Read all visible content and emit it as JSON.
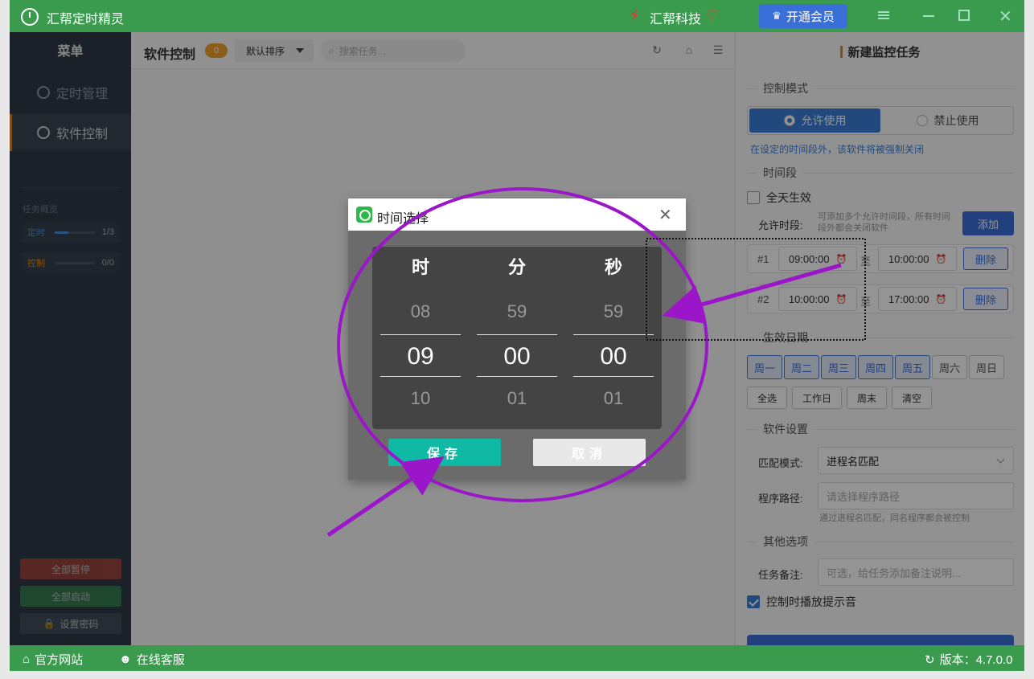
{
  "app": {
    "title": "汇帮定时精灵",
    "brand": "汇帮科技",
    "vip_label": "开通会员"
  },
  "sidebar": {
    "menu_title": "菜单",
    "items": [
      {
        "label": "定时管理",
        "icon": "alarm-clock-icon"
      },
      {
        "label": "软件控制",
        "icon": "gear-icon"
      }
    ],
    "overview_title": "任务概览",
    "overview": [
      {
        "label": "定时",
        "count": "1/3",
        "progress": 0.33
      },
      {
        "label": "控制",
        "count": "0/0",
        "progress": 0
      }
    ],
    "pause_all": "全部暂停",
    "start_all": "全部启动",
    "set_password": "设置密码"
  },
  "main": {
    "title": "软件控制",
    "count": "0",
    "sort": "默认排序",
    "search_placeholder": "搜索任务..."
  },
  "right": {
    "title": "新建监控任务",
    "mode_section": "控制模式",
    "mode_allow": "允许使用",
    "mode_deny": "禁止使用",
    "mode_hint": "在设定的时间段外，该软件将被强制关闭",
    "period_section": "时间段",
    "allday": "全天生效",
    "allow_label": "允许时段:",
    "allow_hint": "可添加多个允许时间段，所有时间段外都会关闭软件",
    "add": "添加",
    "periods": [
      {
        "index": "#1",
        "start": "09:00:00",
        "to": "至",
        "end": "10:00:00",
        "delete": "删除"
      },
      {
        "index": "#2",
        "start": "10:00:00",
        "to": "至",
        "end": "17:00:00",
        "delete": "删除"
      }
    ],
    "date_section": "生效日期",
    "days": [
      "周一",
      "周二",
      "周三",
      "周四",
      "周五",
      "周六",
      "周日"
    ],
    "days_selected": [
      true,
      true,
      true,
      true,
      true,
      false,
      false
    ],
    "quick": [
      "全选",
      "工作日",
      "周末",
      "清空"
    ],
    "software_section": "软件设置",
    "match_label": "匹配模式:",
    "match_value": "进程名匹配",
    "path_label": "程序路径:",
    "path_placeholder": "请选择程序路径",
    "path_hint": "通过进程名匹配，同名程序都会被控制",
    "other_section": "其他选项",
    "note_label": "任务备注:",
    "note_placeholder": "可选，给任务添加备注说明...",
    "sound_label": "控制时播放提示音",
    "sound_checked": true
  },
  "statusbar": {
    "site": "官方网站",
    "service": "在线客服",
    "version": "版本：4.7.0.0"
  },
  "dialog": {
    "title": "时间选择",
    "columns": [
      {
        "head": "时",
        "prev": "08",
        "current": "09",
        "next": "10"
      },
      {
        "head": "分",
        "prev": "59",
        "current": "00",
        "next": "01"
      },
      {
        "head": "秒",
        "prev": "59",
        "current": "00",
        "next": "01"
      }
    ],
    "save": "保存",
    "cancel": "取消"
  },
  "colors": {
    "titlebar": "#3a9a4e",
    "accent": "#3b6fd8",
    "save": "#10b9a3",
    "annotation": "#9a16c8"
  }
}
